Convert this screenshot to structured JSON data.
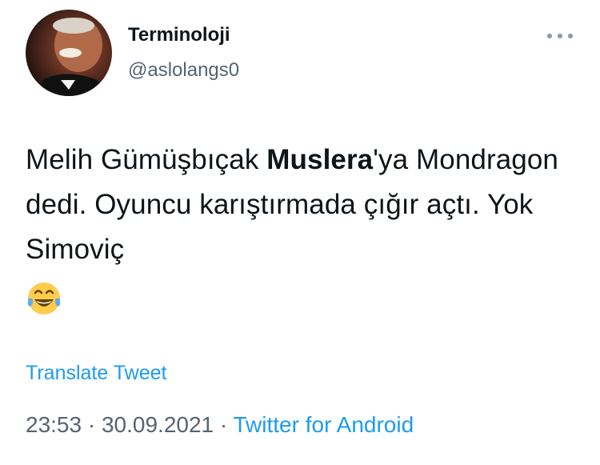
{
  "author": {
    "name": "Terminoloji",
    "handle": "@aslolangs0",
    "avatar": "avatar"
  },
  "more_icon": "more-horizontal-icon",
  "tweet": {
    "text_before": "Melih Gümüşbıçak ",
    "text_bold": "Muslera",
    "text_after": "'ya Mondragon dedi. Oyuncu karıştırmada çığır açtı. Yok Simoviç",
    "emoji": "face-with-tears-of-joy-emoji"
  },
  "translate_label": "Translate Tweet",
  "meta": {
    "time": "23:53",
    "separator": "·",
    "date": "30.09.2021",
    "source": "Twitter for Android"
  },
  "colors": {
    "link": "#1d9bf0",
    "secondary": "#536471",
    "text": "#0f1419"
  }
}
